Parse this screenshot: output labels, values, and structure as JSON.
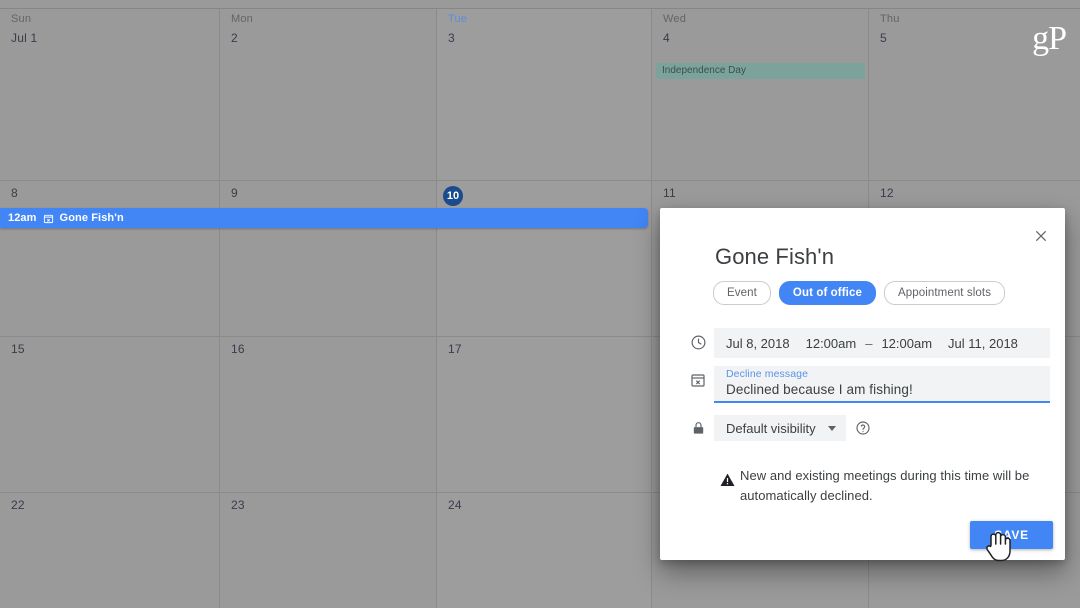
{
  "calendar": {
    "day_headers": [
      "Sun",
      "Mon",
      "Tue",
      "Wed",
      "Thu"
    ],
    "today_header": "Tue",
    "weeks": [
      {
        "days": [
          {
            "label": "Jul 1",
            "today": false
          },
          {
            "label": "2",
            "today": false
          },
          {
            "label": "3",
            "today": false
          },
          {
            "label": "4",
            "today": false
          },
          {
            "label": "5",
            "today": false
          }
        ]
      },
      {
        "days": [
          {
            "label": "8",
            "today": false
          },
          {
            "label": "9",
            "today": false
          },
          {
            "label": "10",
            "today": true
          },
          {
            "label": "11",
            "today": false
          },
          {
            "label": "12",
            "today": false
          }
        ]
      },
      {
        "days": [
          {
            "label": "15",
            "today": false
          },
          {
            "label": "16",
            "today": false
          },
          {
            "label": "17",
            "today": false
          },
          {
            "label": "",
            "today": false
          },
          {
            "label": "",
            "today": false
          }
        ]
      },
      {
        "days": [
          {
            "label": "22",
            "today": false
          },
          {
            "label": "23",
            "today": false
          },
          {
            "label": "24",
            "today": false
          },
          {
            "label": "",
            "today": false
          },
          {
            "label": "",
            "today": false
          }
        ]
      }
    ],
    "holiday_event": {
      "title": "Independence Day",
      "color": "#7ba39c"
    },
    "ooo_event": {
      "time": "12am",
      "title": "Gone Fish'n",
      "icon": "out-of-office-icon",
      "color": "#4285f4"
    },
    "watermark": "gP"
  },
  "dialog": {
    "title": "Gone Fish'n",
    "close_icon": "close-icon",
    "tabs": [
      {
        "label": "Event",
        "active": false
      },
      {
        "label": "Out of office",
        "active": true
      },
      {
        "label": "Appointment slots",
        "active": false
      }
    ],
    "when": {
      "icon": "clock-icon",
      "start_date": "Jul 8, 2018",
      "start_time": "12:00am",
      "separator": "–",
      "end_time": "12:00am",
      "end_date": "Jul 11, 2018"
    },
    "decline": {
      "icon": "out-of-office-icon",
      "label": "Decline message",
      "value": "Declined because I am fishing!"
    },
    "visibility": {
      "icon": "lock-icon",
      "selected": "Default visibility",
      "caret_icon": "chevron-down-icon",
      "help_icon": "help-circle-icon"
    },
    "warning": {
      "icon": "warning-triangle-icon",
      "text": "New and existing meetings during this time will be automatically declined."
    },
    "save_label": "SAVE"
  },
  "colors": {
    "accent": "#4285f4",
    "today_badge": "#1a4b8c",
    "holiday": "#7ba39c",
    "field_bg": "#f1f3f4",
    "text": "#3c4043"
  }
}
